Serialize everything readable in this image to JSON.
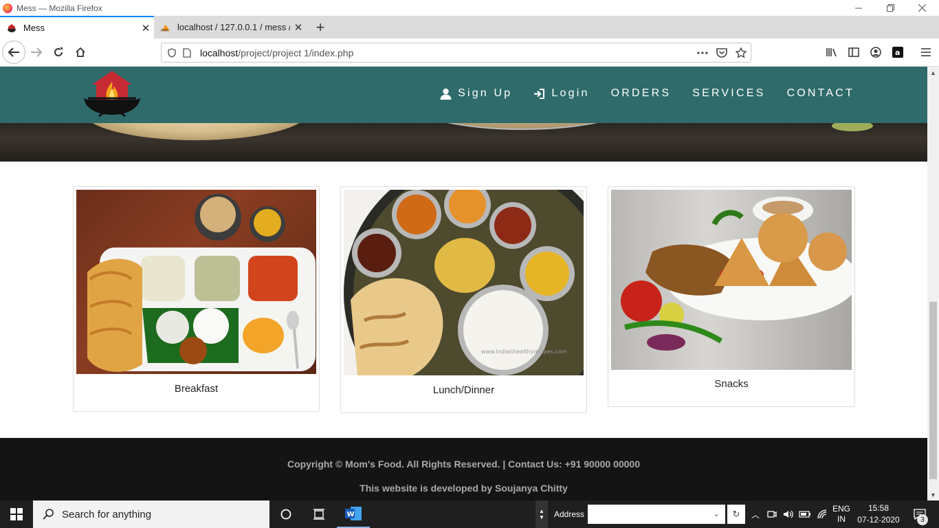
{
  "window": {
    "title": "Mess — Mozilla Firefox",
    "tabs": [
      {
        "label": "Mess",
        "active": true
      },
      {
        "label": "localhost / 127.0.0.1 / mess / us",
        "active": false
      }
    ],
    "url_host": "localhost",
    "url_path": "/project/project 1/index.php"
  },
  "site": {
    "nav": {
      "signup": "Sign Up",
      "login": "Login",
      "orders": "ORDERS",
      "services": "SERVICES",
      "contact": "CONTACT"
    },
    "cards": [
      {
        "caption": "Breakfast"
      },
      {
        "caption": "Lunch/Dinner",
        "watermark": "www.indianhealthyrecipes.com"
      },
      {
        "caption": "Snacks"
      }
    ],
    "footer": {
      "copyright": "Copyright © Mom's Food. All Rights Reserved. | Contact Us: +91 90000 00000",
      "developer": "This website is developed by Soujanya Chitty"
    },
    "colors": {
      "header": "#2e6b6a",
      "footer": "#141414"
    }
  },
  "taskbar": {
    "search_placeholder": "Search for anything",
    "address_label": "Address",
    "lang_top": "ENG",
    "lang_bottom": "IN",
    "time": "15:58",
    "date": "07-12-2020",
    "notification_count": "3"
  }
}
